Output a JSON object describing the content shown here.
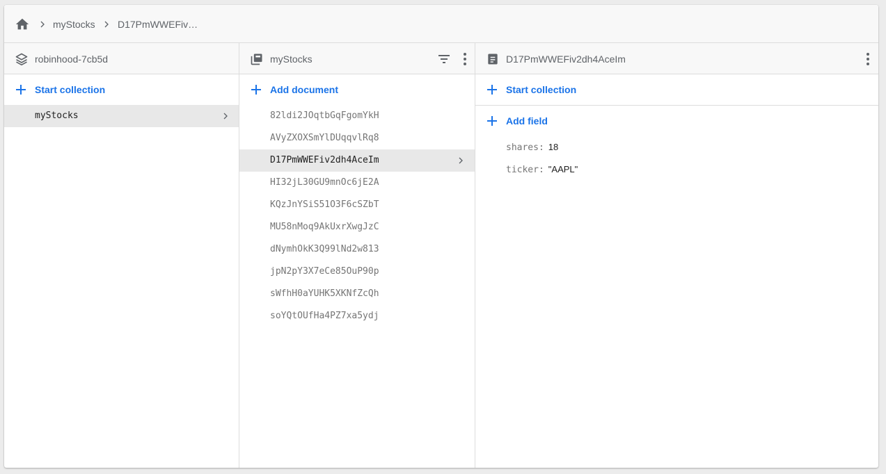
{
  "breadcrumb": {
    "items": [
      "myStocks",
      "D17PmWWEFiv…"
    ]
  },
  "project_column": {
    "title": "robinhood-7cb5d",
    "action_label": "Start collection",
    "items": [
      "myStocks"
    ]
  },
  "collection_column": {
    "title": "myStocks",
    "action_label": "Add document",
    "documents": [
      "82ldi2JOqtbGqFgomYkH",
      "AVyZXOXSmYlDUqqvlRq8",
      "D17PmWWEFiv2dh4AceIm",
      "HI32jL30GU9mnOc6jE2A",
      "KQzJnYSiS51O3F6cSZbT",
      "MU58nMoq9AkUxrXwgJzC",
      "dNymhOkK3Q99lNd2w813",
      "jpN2pY3X7eCe85OuP90p",
      "sWfhH0aYUHK5XKNfZcQh",
      "soYQtOUfHa4PZ7xa5ydj"
    ],
    "selected_index": 2
  },
  "document_column": {
    "title": "D17PmWWEFiv2dh4AceIm",
    "start_collection_label": "Start collection",
    "add_field_label": "Add field",
    "fields": [
      {
        "key": "shares:",
        "value": "18"
      },
      {
        "key": "ticker:",
        "value": "\"AAPL\""
      }
    ]
  },
  "colors": {
    "accent": "#1a73e8",
    "selected_row": "#e8e8e8",
    "header_bg": "#f8f8f8"
  },
  "icons": [
    "home-icon",
    "chevron-right-icon",
    "database-icon",
    "collection-icon",
    "filter-icon",
    "more-vert-icon",
    "document-icon",
    "plus-icon"
  ]
}
